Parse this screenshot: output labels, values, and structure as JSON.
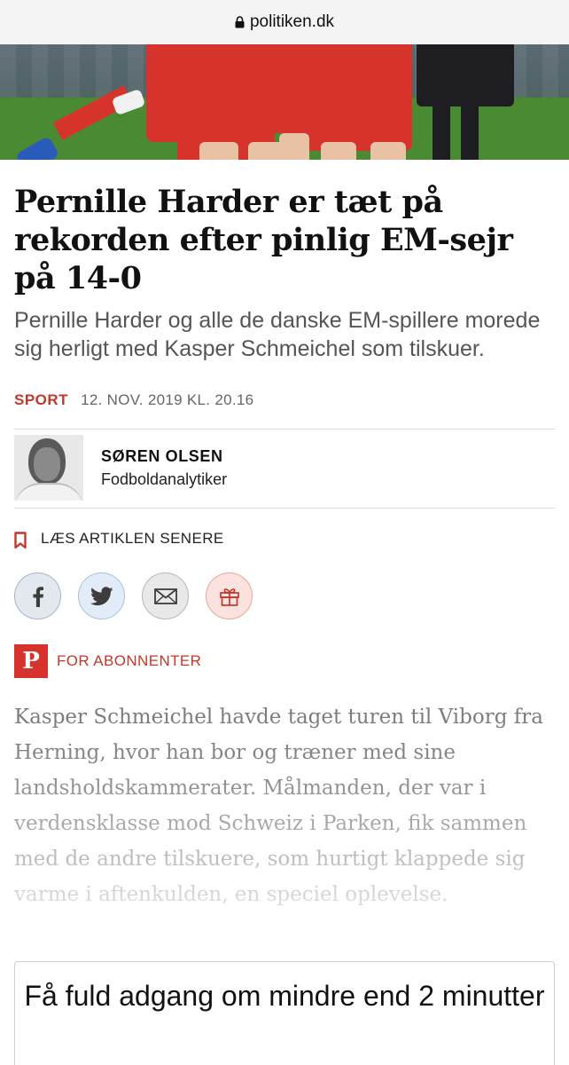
{
  "browser": {
    "url": "politiken.dk"
  },
  "article": {
    "headline": "Pernille Harder er tæt på rekorden efter pinlig EM-sejr på 14-0",
    "subheading": "Pernille Harder og alle de danske EM-spillere morede sig herligt med Kasper Schmeichel som tilskuer.",
    "section": "SPORT",
    "date": "12. NOV. 2019 KL. 20.16",
    "author": {
      "name": "SØREN OLSEN",
      "role": "Fodboldanalytiker"
    },
    "read_later_label": "LÆS ARTIKLEN SENERE",
    "share_buttons": [
      {
        "icon": "facebook-icon"
      },
      {
        "icon": "twitter-icon"
      },
      {
        "icon": "mail-icon"
      },
      {
        "icon": "gift-icon"
      }
    ],
    "subscriber_badge": {
      "logo": "P",
      "label": "FOR ABONNENTER"
    },
    "body": "Kasper Schmeichel havde taget turen til Viborg fra Herning, hvor han bor og træner med sine landsholdskammerater. Målmanden, der var i verdensklasse mod Schweiz i Parken, fik sammen med de andre tilskuere, som hurtigt klappede sig varme i aftenkulden, en speciel oplevelse."
  },
  "paywall": {
    "title": "Få fuld adgang om mindre end 2 minutter"
  },
  "colors": {
    "accent": "#c0392b",
    "brand_red": "#d6332c"
  }
}
